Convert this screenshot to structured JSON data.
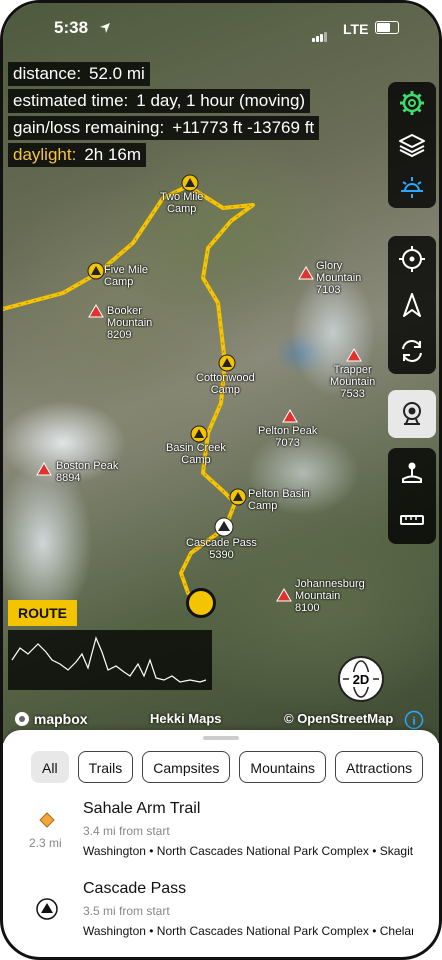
{
  "status": {
    "time": "5:38",
    "network": "LTE"
  },
  "stats": {
    "distance": {
      "label": "distance:",
      "value": "52.0 mi"
    },
    "time": {
      "label": "estimated time:",
      "value": "1 day, 1 hour (moving)"
    },
    "gain": {
      "label": "gain/loss remaining:",
      "value": "+11773 ft -13769 ft"
    },
    "daylight": {
      "label": "daylight:",
      "value": "2h 16m"
    }
  },
  "toolbar": {
    "top": [
      "gear-icon",
      "layers-icon",
      "sun-icon"
    ],
    "mid": [
      "crosshair-icon",
      "compass-arrow-icon",
      "sync-icon",
      "camera-icon"
    ],
    "bottom": [
      "joystick-icon",
      "ruler-icon"
    ]
  },
  "map_labels": {
    "two_mile": "Two Mile\nCamp",
    "five_mile": "Five Mile\nCamp",
    "booker": "Booker\nMountain\n8209",
    "glory": "Glory\nMountain\n7103",
    "cottonwood": "Cottonwood\nCamp",
    "trapper": "Trapper\nMountain\n7533",
    "pelton_peak": "Pelton Peak\n7073",
    "basin_creek": "Basin Creek\nCamp",
    "boston": "Boston Peak\n8894",
    "pelton_basin": "Pelton Basin\nCamp",
    "cascade": "Cascade Pass\n5390",
    "johannesburg": "Johannesburg\nMountain\n8100"
  },
  "route_label": "ROUTE",
  "view_toggle": "2D",
  "credits": {
    "mapbox": "mapbox",
    "hekki": "Hekki Maps",
    "osm": "© OpenStreetMap"
  },
  "colors": {
    "route": "#f5c400",
    "accent_green": "#3ddc6b",
    "accent_blue": "#2aa8ff",
    "daylight": "#f5c542"
  },
  "filters": [
    "All",
    "Trails",
    "Campsites",
    "Mountains",
    "Attractions"
  ],
  "selected_filter": "All",
  "results": [
    {
      "title": "Sahale Arm Trail",
      "sub": "3.4 mi from start",
      "location": "Washington • North Cascades National Park Complex • Skagit County",
      "distance": "2.3 mi",
      "icon": "trail-diamond-icon"
    },
    {
      "title": "Cascade Pass",
      "sub": "3.5 mi from start",
      "location": "Washington • North Cascades National Park Complex • Chelan County",
      "icon": "peak-triangle-icon"
    }
  ]
}
